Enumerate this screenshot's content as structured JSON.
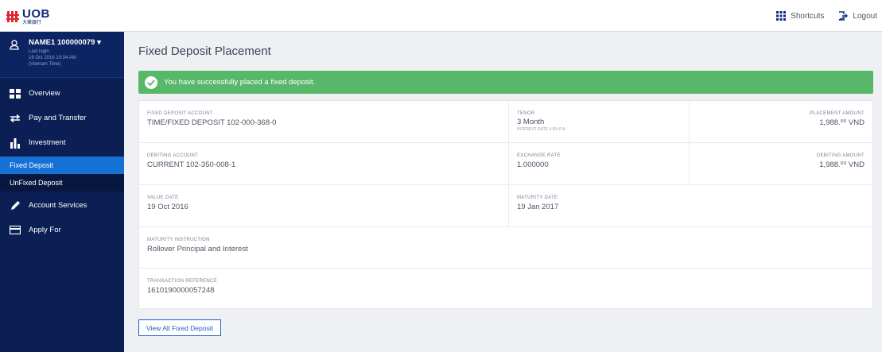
{
  "logo": {
    "name": "UOB",
    "subtitle": "大華銀行"
  },
  "topbar": {
    "shortcuts_label": "Shortcuts",
    "logout_label": "Logout"
  },
  "user": {
    "name": "NAME1 100000079",
    "last_login_label": "Last login",
    "last_login_value": "19 Oct 2016 10:04 AM",
    "timezone": "(Vietnam Time)"
  },
  "sidebar": {
    "items": [
      {
        "label": "Overview",
        "icon": "grid-icon"
      },
      {
        "label": "Pay and Transfer",
        "icon": "transfer-arrows-icon"
      },
      {
        "label": "Investment",
        "icon": "bar-chart-icon"
      },
      {
        "label": "Account Services",
        "icon": "pencil-icon"
      },
      {
        "label": "Apply For",
        "icon": "card-icon"
      }
    ],
    "subitems": [
      {
        "label": "Fixed Deposit",
        "active": true
      },
      {
        "label": "UnFixed Deposit",
        "active": false
      }
    ]
  },
  "page": {
    "title": "Fixed Deposit Placement",
    "success_message": "You have successfully placed a fixed deposit."
  },
  "details": {
    "fixed_deposit_account": {
      "label": "FIXED DEPOSIT ACCOUNT",
      "value": "TIME/FIXED DEPOSIT 102-000-368-0"
    },
    "tenor": {
      "label": "TENOR",
      "value": "3 Month",
      "note": "INTEREST RATE 4.5% p.a."
    },
    "placement_amount": {
      "label": "PLACEMENT AMOUNT",
      "value": "1,988.⁰⁰ VND"
    },
    "debiting_account": {
      "label": "DEBITING ACCOUNT",
      "value": "CURRENT 102-350-008-1"
    },
    "exchange_rate": {
      "label": "EXCHANGE RATE",
      "value": "1.000000"
    },
    "debiting_amount": {
      "label": "DEBITING AMOUNT",
      "value": "1,988.⁰⁰ VND"
    },
    "value_date": {
      "label": "VALUE DATE",
      "value": "19 Oct 2016"
    },
    "maturity_date": {
      "label": "MATURITY DATE",
      "value": "19 Jan 2017"
    },
    "maturity_instruction": {
      "label": "MATURITY INSTRUCTION",
      "value": "Rollover Principal and Interest"
    },
    "transaction_reference": {
      "label": "TRANSACTION REFERENCE",
      "value": "1610190000057248"
    }
  },
  "actions": {
    "view_all_label": "View All Fixed Deposit"
  },
  "colors": {
    "brand_navy": "#0b1f55",
    "active_blue": "#1572d4",
    "success_green": "#58b86a"
  }
}
